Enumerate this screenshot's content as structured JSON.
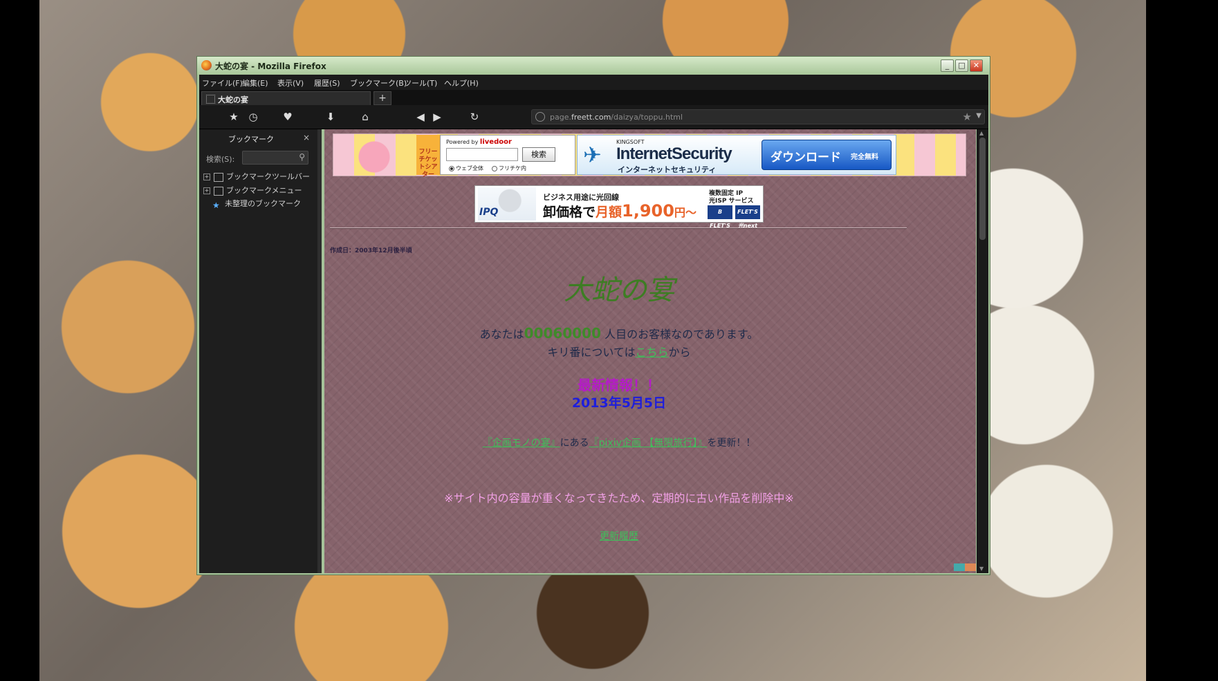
{
  "window": {
    "title": "大蛇の宴 - Mozilla Firefox",
    "controls": {
      "minimize": "_",
      "maximize": "□",
      "close": "✕"
    }
  },
  "menubar": [
    "ファイル(F)",
    "編集(E)",
    "表示(V)",
    "履歴(S)",
    "ブックマーク(B)",
    "ツール(T)",
    "ヘルプ(H)"
  ],
  "tab": {
    "label": "大蛇の宴",
    "new_tab": "+"
  },
  "toolbar": {
    "icons": [
      "bookmark-star-icon",
      "history-clock-icon",
      "addon-icon",
      "download-icon",
      "home-icon",
      "back-icon",
      "forward-icon",
      "reload-icon"
    ]
  },
  "urlbar": {
    "prefix": "page.",
    "host": "freett.com",
    "path": "/daizya/toppu.html"
  },
  "sidebar": {
    "title": "ブックマーク",
    "close": "×",
    "search_label": "検索(S):",
    "items": [
      {
        "label": "ブックマークツールバー",
        "expander": "+"
      },
      {
        "label": "ブックマークメニュー",
        "expander": "+"
      },
      {
        "label": "未整理のブックマーク"
      }
    ]
  },
  "ads": {
    "ticket_logo": "フリーチケットシアター",
    "livedoor": {
      "powered": "Powered by ",
      "brand": "livedoor",
      "search_button": "検索",
      "radio_web": "ウェブ全体",
      "radio_site": "フリチケ内"
    },
    "kingsoft": {
      "brand": "KINGSOFT",
      "product": "InternetSecurity",
      "product_jp": "インターネットセキュリティ",
      "download": "ダウンロード",
      "free": "完全無料"
    },
    "ipq": {
      "logo": "IPQ",
      "line1": "ビジネス用途に光回線",
      "line2_prefix": "卸価格で",
      "line2_monthly": "月額",
      "price": "1,900",
      "line2_suffix": "円～",
      "right1": "複数固定 IP",
      "right2": "光ISP サービス",
      "flets1": "B FLET'S",
      "flets2": "FLET'S 光next"
    }
  },
  "page": {
    "created_date": "作成日：2003年12月後半頃",
    "site_title": "大蛇の宴",
    "visitor_prefix": "あなたは",
    "visitor_count": "00060000",
    "visitor_suffix": "人目のお客様なのであります。",
    "kiriban_prefix": "キリ番については",
    "kiriban_link": "こちら",
    "kiriban_suffix": "から",
    "news_heading": "最新情報！！",
    "news_date": "2013年5月5日",
    "update_link1": "『企画モノの宴』",
    "update_mid": "にある",
    "update_link2": "『pixiv企画 【無限旅行】』",
    "update_suffix": "を更新！！",
    "notice": "※サイト内の容量が重くなってきたため、定期的に古い作品を削除中※",
    "history_link": "更新履歴"
  }
}
